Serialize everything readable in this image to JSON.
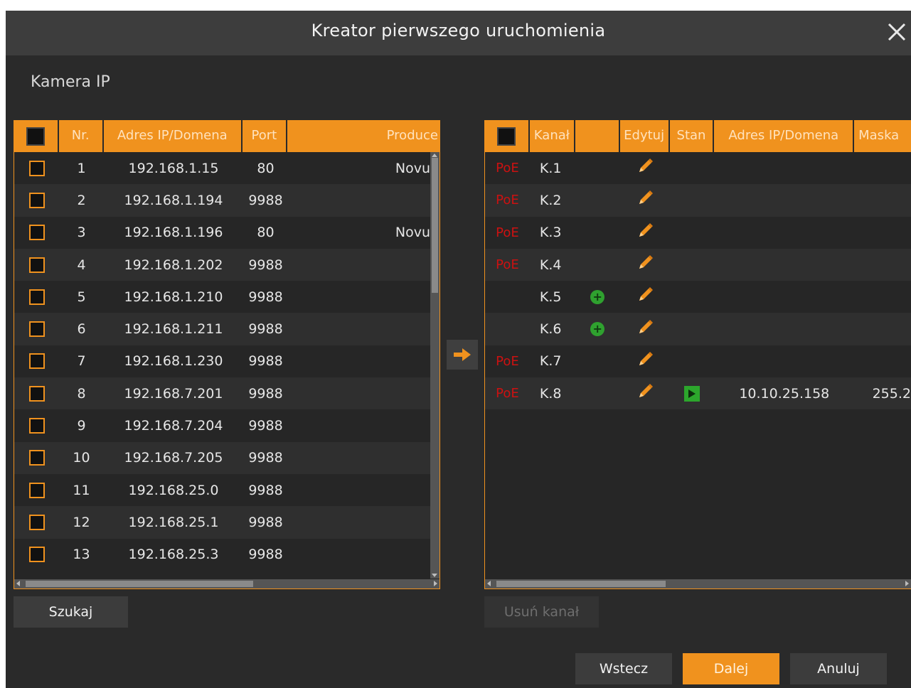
{
  "window": {
    "title": "Kreator pierwszego uruchomienia"
  },
  "section_label": "Kamera IP",
  "left_table": {
    "headers": {
      "nr": "Nr.",
      "address": "Adres IP/Domena",
      "port": "Port",
      "producer": "Produce"
    },
    "rows": [
      {
        "nr": "1",
        "address": "192.168.1.15",
        "port": "80",
        "producer": "Novu"
      },
      {
        "nr": "2",
        "address": "192.168.1.194",
        "port": "9988",
        "producer": ""
      },
      {
        "nr": "3",
        "address": "192.168.1.196",
        "port": "80",
        "producer": "Novu"
      },
      {
        "nr": "4",
        "address": "192.168.1.202",
        "port": "9988",
        "producer": ""
      },
      {
        "nr": "5",
        "address": "192.168.1.210",
        "port": "9988",
        "producer": ""
      },
      {
        "nr": "6",
        "address": "192.168.1.211",
        "port": "9988",
        "producer": ""
      },
      {
        "nr": "7",
        "address": "192.168.1.230",
        "port": "9988",
        "producer": ""
      },
      {
        "nr": "8",
        "address": "192.168.7.201",
        "port": "9988",
        "producer": ""
      },
      {
        "nr": "9",
        "address": "192.168.7.204",
        "port": "9988",
        "producer": ""
      },
      {
        "nr": "10",
        "address": "192.168.7.205",
        "port": "9988",
        "producer": ""
      },
      {
        "nr": "11",
        "address": "192.168.25.0",
        "port": "9988",
        "producer": ""
      },
      {
        "nr": "12",
        "address": "192.168.25.1",
        "port": "9988",
        "producer": ""
      },
      {
        "nr": "13",
        "address": "192.168.25.3",
        "port": "9988",
        "producer": ""
      }
    ]
  },
  "right_table": {
    "headers": {
      "channel": "Kanał",
      "add": "",
      "edit": "Edytuj",
      "status": "Stan",
      "address": "Adres IP/Domena",
      "mask": "Maska"
    },
    "rows": [
      {
        "poe": "PoE",
        "channel": "K.1",
        "add": false,
        "status": false,
        "address": "",
        "mask": ""
      },
      {
        "poe": "PoE",
        "channel": "K.2",
        "add": false,
        "status": false,
        "address": "",
        "mask": ""
      },
      {
        "poe": "PoE",
        "channel": "K.3",
        "add": false,
        "status": false,
        "address": "",
        "mask": ""
      },
      {
        "poe": "PoE",
        "channel": "K.4",
        "add": false,
        "status": false,
        "address": "",
        "mask": ""
      },
      {
        "poe": "",
        "channel": "K.5",
        "add": true,
        "status": false,
        "address": "",
        "mask": ""
      },
      {
        "poe": "",
        "channel": "K.6",
        "add": true,
        "status": false,
        "address": "",
        "mask": ""
      },
      {
        "poe": "PoE",
        "channel": "K.7",
        "add": false,
        "status": false,
        "address": "",
        "mask": ""
      },
      {
        "poe": "PoE",
        "channel": "K.8",
        "add": false,
        "status": true,
        "address": "10.10.25.158",
        "mask": "255.2"
      }
    ]
  },
  "buttons": {
    "search": "Szukaj",
    "remove_channel": "Usuń kanał",
    "back": "Wstecz",
    "next": "Dalej",
    "cancel": "Anuluj"
  },
  "colors": {
    "accent": "#f0921e",
    "poe": "#cc1111",
    "add_icon": "#2fa12f",
    "play_icon": "#2ca62c"
  },
  "icons": {
    "close": "close-icon",
    "transfer": "arrow-right-icon",
    "edit": "pencil-icon",
    "add": "plus-circle-icon",
    "status": "play-icon"
  }
}
